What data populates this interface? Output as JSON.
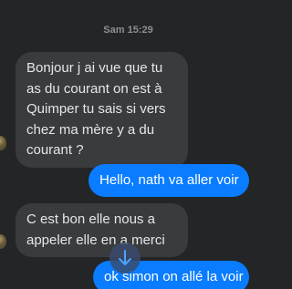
{
  "chat": {
    "timestamp": "Sam 15:29",
    "messages": [
      {
        "direction": "incoming",
        "text": "Bonjour j ai vue que tu as du courant on est à Quimper tu sais si vers chez ma mère y a du courant ?"
      },
      {
        "direction": "outgoing",
        "text": "Hello, nath va aller voir"
      },
      {
        "direction": "incoming",
        "text": "C est bon elle nous a appeler elle en a merci"
      },
      {
        "direction": "outgoing",
        "text": "ok simon on allé la voir"
      }
    ],
    "scroll_button_icon": "arrow-down-icon"
  },
  "colors": {
    "background": "#242526",
    "incoming_bubble": "#3a3b3c",
    "outgoing_bubble": "#0a7cff",
    "incoming_text": "#e4e6eb",
    "outgoing_text": "#ffffff",
    "timestamp_text": "#8e8f93"
  }
}
